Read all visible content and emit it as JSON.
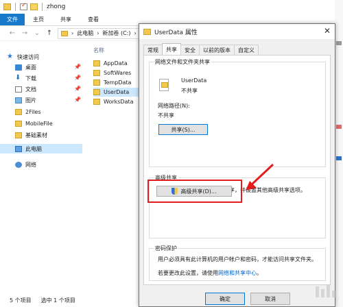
{
  "explorer": {
    "title": "zhong",
    "ribbon_tabs": [
      "文件",
      "主页",
      "共享",
      "查看"
    ],
    "address_parts": [
      "此电脑",
      "新加卷 (C:)"
    ],
    "nav": {
      "quick_access": "快速访问",
      "items": [
        "桌面",
        "下载",
        "文档",
        "图片",
        "2Files",
        "MobileFile",
        "基础素材"
      ],
      "this_pc": "此电脑",
      "network": "网络"
    },
    "list": {
      "column_name": "名称",
      "files": [
        "AppData",
        "SoftWares",
        "TempData",
        "UserData",
        "WorksData"
      ],
      "selected_file": "UserData"
    },
    "status": {
      "count": "5 个项目",
      "selected": "选中 1 个项目"
    }
  },
  "dialog": {
    "title": "UserData 属性",
    "close_glyph": "✕",
    "tabs": [
      "常规",
      "共享",
      "安全",
      "以前的版本",
      "自定义"
    ],
    "active_tab": "共享",
    "network_share": {
      "group_title": "网络文件和文件夹共享",
      "folder_name": "UserData",
      "share_state": "不共享",
      "path_label": "网络路径(N):",
      "path_value": "不共享",
      "share_button": "共享(S)..."
    },
    "advanced_share": {
      "group_title": "高级共享",
      "description": "设置自定义权限，创建多个共享，并设置其他高级共享选项。",
      "button": "高级共享(D)..."
    },
    "password": {
      "group_title": "密码保护",
      "description": "用户必须具有此计算机的用户帐户和密码，才能访问共享文件夹。",
      "change_text": "若要更改此设置，请使用",
      "link_text": "网络和共享中心",
      "period": "。"
    },
    "footer": {
      "ok": "确定",
      "cancel": "取消"
    }
  },
  "colors": {
    "file_tab": "#1979ca",
    "selection": "#cce8ff",
    "highlight_box": "#e21c1c",
    "link": "#0066cc"
  }
}
